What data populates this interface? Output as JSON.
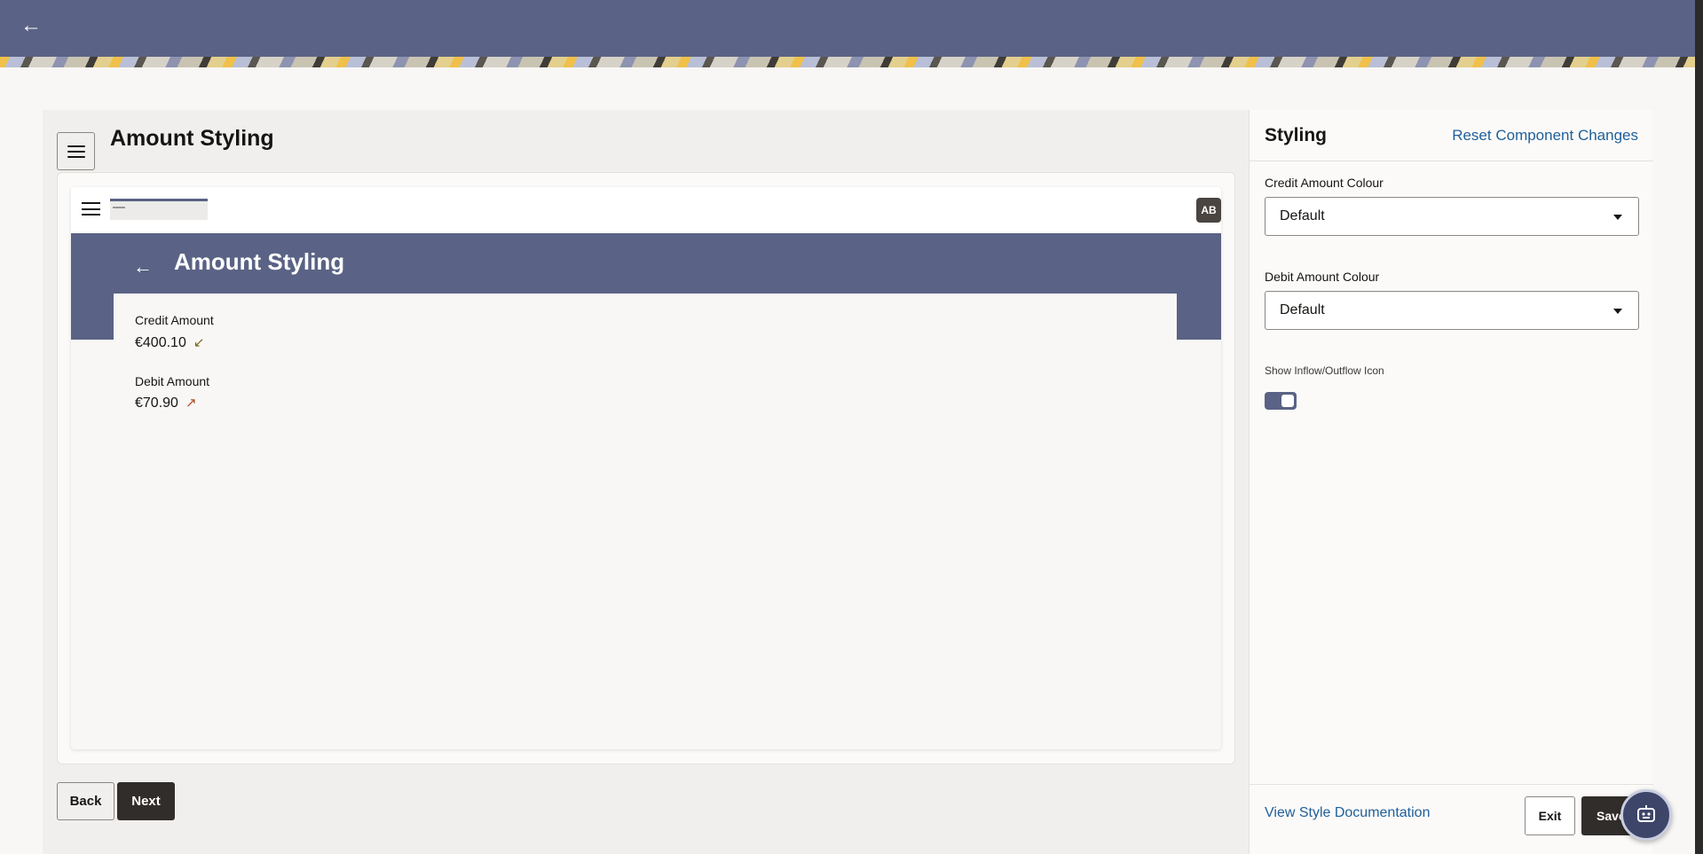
{
  "header": {
    "back_icon": "arrow-left-icon"
  },
  "editor": {
    "page_title": "Amount Styling",
    "menu_icon": "hamburger-icon",
    "preview": {
      "avatar_initials": "AB",
      "banner_title": "Amount Styling",
      "credit_label": "Credit Amount",
      "credit_value": "€400.10",
      "credit_icon": "↙",
      "debit_label": "Debit Amount",
      "debit_value": "€70.90",
      "debit_icon": "↗"
    },
    "back_label": "Back",
    "next_label": "Next"
  },
  "panel": {
    "title": "Styling",
    "reset_label": "Reset Component Changes",
    "credit_colour_label": "Credit Amount Colour",
    "credit_colour_value": "Default",
    "debit_colour_label": "Debit Amount Colour",
    "debit_colour_value": "Default",
    "toggle_label": "Show Inflow/Outflow Icon",
    "toggle_on": true,
    "doc_link": "View Style Documentation",
    "exit_label": "Exit",
    "save_label": "Save"
  },
  "colors": {
    "header_bg": "#5a6385",
    "primary_button": "#312d2a",
    "link": "#1f5f98"
  }
}
